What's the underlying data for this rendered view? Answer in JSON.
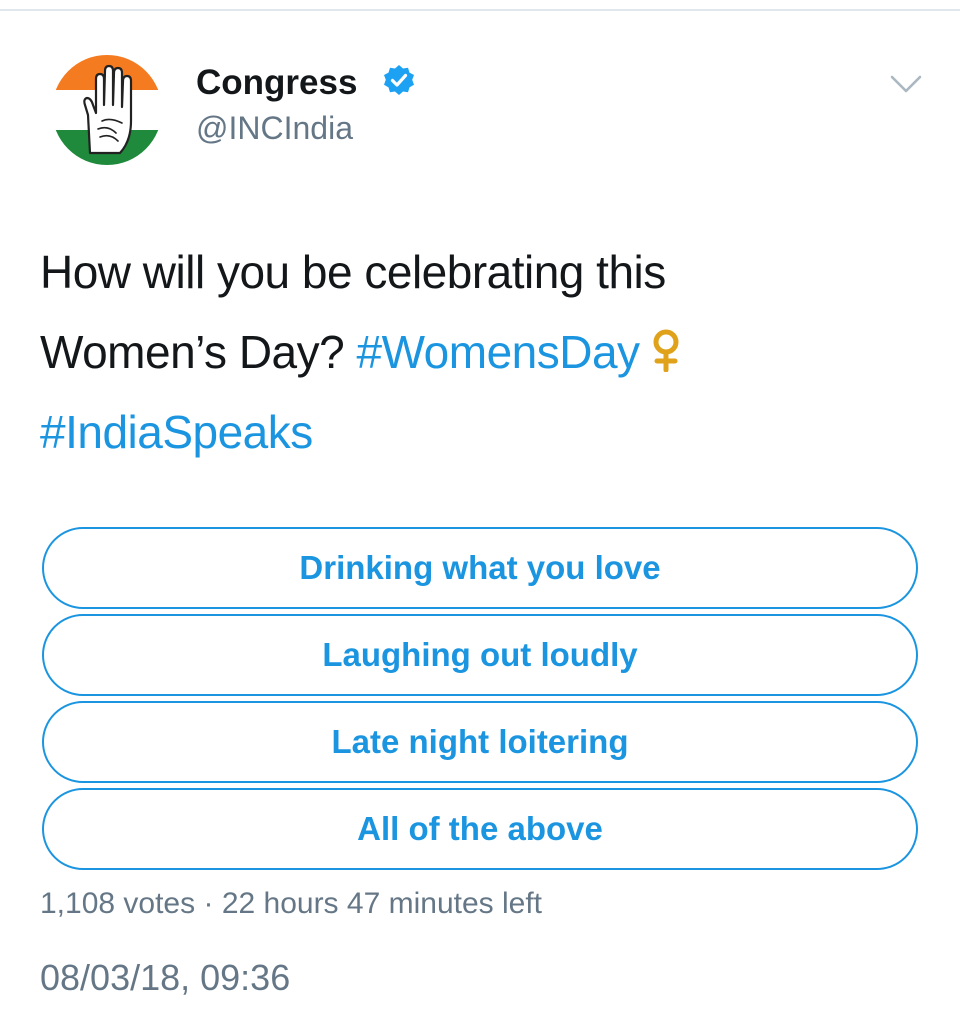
{
  "author": {
    "display_name": "Congress",
    "handle": "@INCIndia",
    "verified": true,
    "avatar_icon": "congress-hand-logo-icon"
  },
  "tweet": {
    "text_line1": "How will you be celebrating this",
    "text_line2_prefix": "Women’s Day? ",
    "hashtag_1": "#WomensDay",
    "emoji_icon": "venus-symbol-icon",
    "hashtag_2": "#IndiaSpeaks"
  },
  "poll": {
    "options": [
      {
        "label": "Drinking what you love"
      },
      {
        "label": "Laughing out loudly"
      },
      {
        "label": "Late night loitering"
      },
      {
        "label": "All of the above"
      }
    ],
    "votes": "1,108 votes",
    "separator": "·",
    "time_left": "22 hours 47 minutes left"
  },
  "timestamp": "08/03/18, 09:36",
  "colors": {
    "accent": "#1b95e0",
    "text": "#14171a",
    "muted": "#657786",
    "saffron": "#f47b20",
    "green": "#1f8a3c"
  }
}
